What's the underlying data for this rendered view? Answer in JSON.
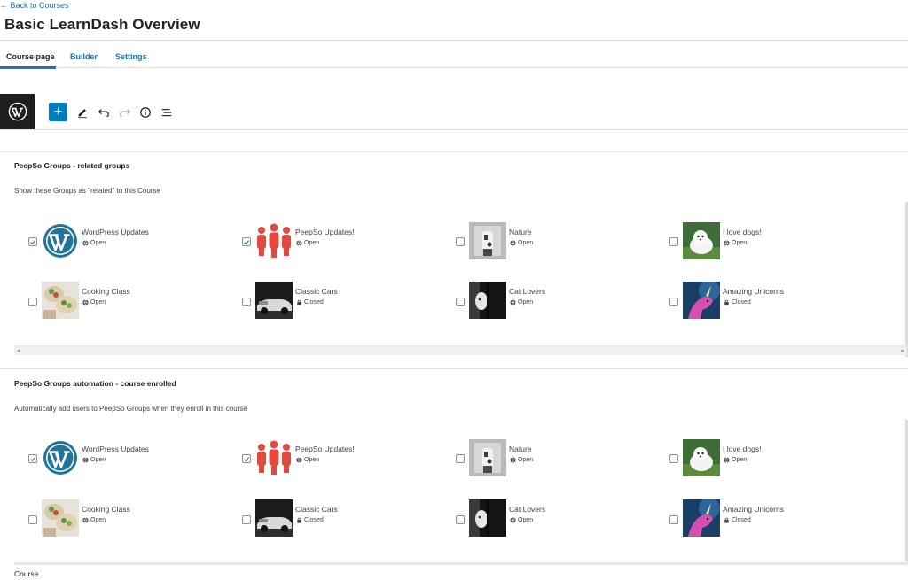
{
  "header": {
    "back_link": "← Back to Courses",
    "title": "Basic LearnDash Overview"
  },
  "tabs": [
    {
      "label": "Course page",
      "active": true
    },
    {
      "label": "Builder",
      "active": false
    },
    {
      "label": "Settings",
      "active": false
    }
  ],
  "toolbar": {
    "add_label": "+",
    "tools": [
      "add-block",
      "edit-tool",
      "undo",
      "redo",
      "details-info",
      "list-view"
    ]
  },
  "sections": [
    {
      "title": "PeepSo Groups - related groups",
      "description": "Show these Groups as \"related\" to this Course",
      "groups": [
        {
          "name": "WordPress Updates",
          "status": "Open",
          "checked": true,
          "thumb": "wordpress-logo"
        },
        {
          "name": "PeepSo Updates!",
          "status": "Open",
          "checked": true,
          "thumb": "peepso-people"
        },
        {
          "name": "Nature",
          "status": "Open",
          "checked": false,
          "thumb": "nature-photo"
        },
        {
          "name": "I love dogs!",
          "status": "Open",
          "checked": false,
          "thumb": "dog-photo"
        },
        {
          "name": "Cooking Class",
          "status": "Open",
          "checked": false,
          "thumb": "cooking-photo"
        },
        {
          "name": "Classic Cars",
          "status": "Closed",
          "checked": false,
          "thumb": "car-photo"
        },
        {
          "name": "Cat Lovers",
          "status": "Open",
          "checked": false,
          "thumb": "cat-photo"
        },
        {
          "name": "Amazing Unicorns",
          "status": "Closed",
          "checked": false,
          "thumb": "unicorn-photo"
        }
      ]
    },
    {
      "title": "PeepSo Groups automation - course enrolled",
      "description": "Automatically add users to PeepSo Groups when they enroll in this course",
      "groups": [
        {
          "name": "WordPress Updates",
          "status": "Open",
          "checked": true,
          "thumb": "wordpress-logo"
        },
        {
          "name": "PeepSo Updates!",
          "status": "Open",
          "checked": true,
          "thumb": "peepso-people"
        },
        {
          "name": "Nature",
          "status": "Open",
          "checked": false,
          "thumb": "nature-photo"
        },
        {
          "name": "I love dogs!",
          "status": "Open",
          "checked": false,
          "thumb": "dog-photo"
        },
        {
          "name": "Cooking Class",
          "status": "Open",
          "checked": false,
          "thumb": "cooking-photo"
        },
        {
          "name": "Classic Cars",
          "status": "Closed",
          "checked": false,
          "thumb": "car-photo"
        },
        {
          "name": "Cat Lovers",
          "status": "Open",
          "checked": false,
          "thumb": "cat-photo"
        },
        {
          "name": "Amazing Unicorns",
          "status": "Closed",
          "checked": false,
          "thumb": "unicorn-photo"
        }
      ]
    }
  ],
  "footer": {
    "breadcrumb": "Course"
  },
  "colors": {
    "accent": "#2271b1",
    "add_button": "#007cba",
    "wp_blue": "#21759b",
    "peepso_red": "#e04a3f"
  }
}
